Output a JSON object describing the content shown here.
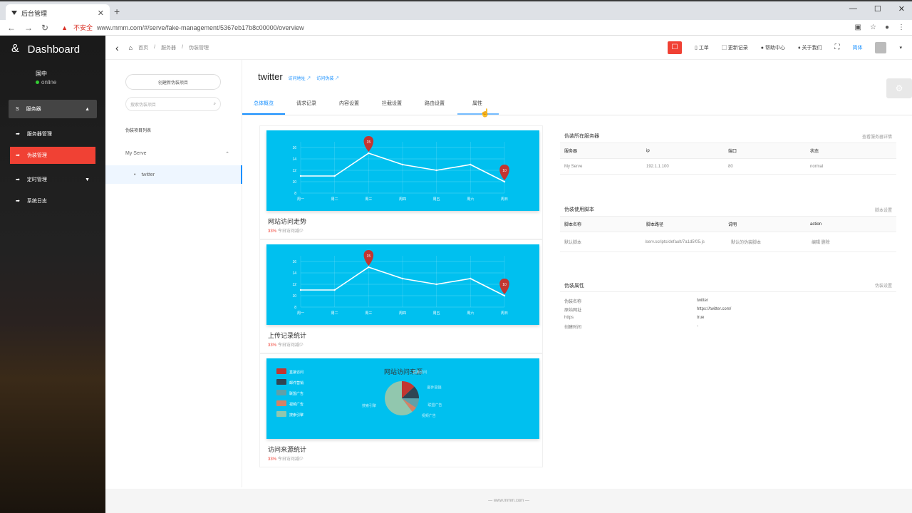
{
  "browser": {
    "tab_title": "后台管理",
    "insecure_label": "不安全",
    "url": "www.mmm.com/#/serve/fake-management/5367eb17b8c00000/overview"
  },
  "sidebar": {
    "brand": "Dashboard",
    "user_name": "国中",
    "user_status": "online",
    "items": [
      {
        "label": "服务器",
        "icon": "S"
      },
      {
        "label": "服务器管理",
        "icon": "➡"
      },
      {
        "label": "伪装管理",
        "icon": "➡"
      },
      {
        "label": "定时管理",
        "icon": "➡"
      },
      {
        "label": "系统日志",
        "icon": "➡"
      }
    ]
  },
  "topbar": {
    "breadcrumb": [
      "首页",
      "服务器",
      "伪装管理"
    ],
    "tools": [
      "工单",
      "更新记录",
      "帮助中心",
      "关于我们"
    ],
    "lang": "简体"
  },
  "left_panel": {
    "new_button": "创建新伪装项目",
    "search_placeholder": "搜索伪装项目",
    "list_label": "伪装项目列表",
    "serve_name": "My Serve",
    "item_name": "twitter"
  },
  "main": {
    "title": "twitter",
    "links": [
      "访问地址 ↗",
      "访问伪装 ↗"
    ],
    "tabs": [
      "总体概览",
      "请求记录",
      "内容设置",
      "拦截设置",
      "路由设置",
      "属性"
    ],
    "cards": [
      {
        "title": "网站访问走势",
        "pct": "33%",
        "sub": "今日访问减少"
      },
      {
        "title": "上传记录统计",
        "pct": "33%",
        "sub": "今日访问减少"
      },
      {
        "title": "访问来源统计",
        "pct": "33%",
        "sub": "今日访问减少"
      }
    ]
  },
  "chart_data": [
    {
      "type": "line",
      "categories": [
        "周一",
        "周二",
        "周三",
        "周四",
        "周五",
        "周六",
        "周日"
      ],
      "series": [
        {
          "values": [
            11,
            11,
            15,
            13,
            12,
            13,
            10
          ]
        }
      ],
      "y_ticks": [
        "8",
        "10",
        "12",
        "14",
        "16"
      ],
      "ylim": [
        8,
        17
      ],
      "markers": [
        {
          "label": "15",
          "index": 2
        },
        {
          "label": "10",
          "index": 6
        }
      ],
      "grid": true
    },
    {
      "type": "line",
      "categories": [
        "周一",
        "周二",
        "周三",
        "周四",
        "周五",
        "周六",
        "周日"
      ],
      "series": [
        {
          "values": [
            11,
            11,
            15,
            13,
            12,
            13,
            10
          ]
        }
      ],
      "y_ticks": [
        "8",
        "10",
        "12",
        "14",
        "16"
      ],
      "ylim": [
        8,
        17
      ],
      "markers": [
        {
          "label": "15",
          "index": 2
        },
        {
          "label": "10",
          "index": 6
        }
      ],
      "grid": true
    },
    {
      "type": "pie",
      "title": "网站访问来源",
      "legend": [
        "直接访问",
        "邮件营销",
        "联盟广告",
        "视频广告",
        "搜索引擎"
      ],
      "values": [
        335,
        310,
        234,
        135,
        1548
      ],
      "colors": [
        "#c23531",
        "#2f4554",
        "#61a0a8",
        "#d48265",
        "#91c7ae"
      ],
      "legend_position": "left"
    }
  ],
  "right_panel": {
    "server_section": {
      "title": "伪装所在服务器",
      "action": "查看服务器详情",
      "headers": [
        "服务器",
        "ip",
        "端口",
        "状态"
      ],
      "row": [
        "My Serve",
        "192.1.1.100",
        "80",
        "normal"
      ]
    },
    "script_section": {
      "title": "伪装使用脚本",
      "action": "脚本设置",
      "headers": [
        "脚本名称",
        "脚本路径",
        "说明",
        "action"
      ],
      "row": [
        "默认脚本",
        "/serv.scripts/default/7a1d5f05.js",
        "默认的伪装脚本",
        "编辑 删除"
      ]
    },
    "attr_section": {
      "title": "伪装属性",
      "action": "伪装设置",
      "props": [
        {
          "k": "伪装名称",
          "v": "twitter"
        },
        {
          "k": "原始网址",
          "v": "https://twitter.com/"
        },
        {
          "k": "https",
          "v": "true"
        },
        {
          "k": "创建时间",
          "v": "-"
        }
      ]
    }
  },
  "footer": "— www.mmm.com —"
}
